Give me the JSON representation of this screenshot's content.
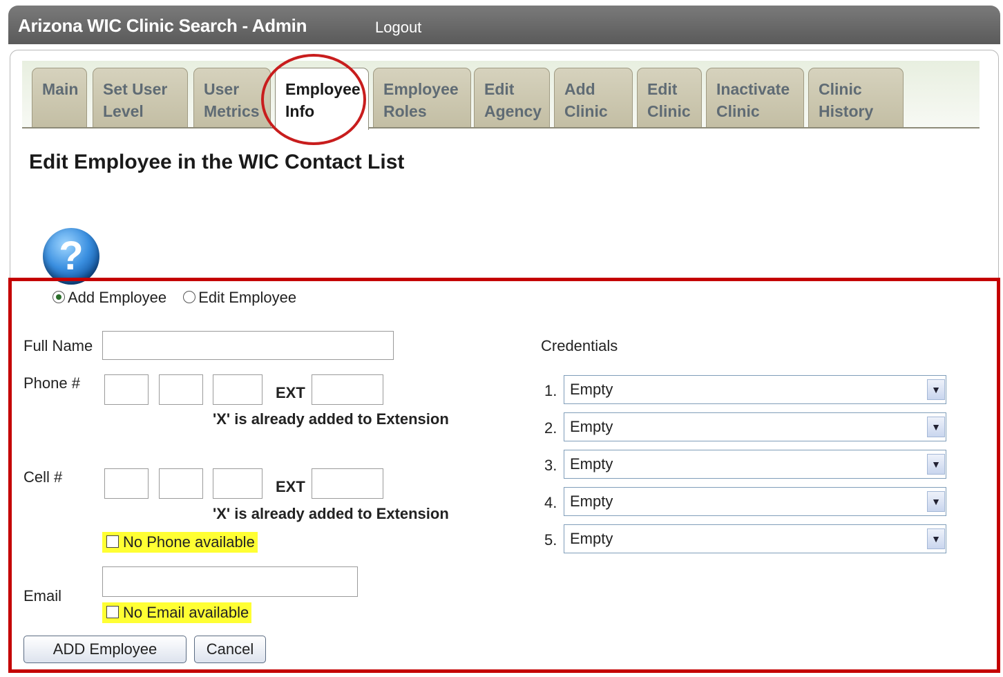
{
  "header": {
    "title": "Arizona WIC Clinic Search - Admin",
    "logout_label": "Logout"
  },
  "tabs": [
    {
      "line1": "Main",
      "line2": ""
    },
    {
      "line1": "Set User",
      "line2": "Level"
    },
    {
      "line1": "User",
      "line2": "Metrics"
    },
    {
      "line1": "Employee",
      "line2": "Info",
      "active": true
    },
    {
      "line1": "Employee",
      "line2": "Roles"
    },
    {
      "line1": "Edit",
      "line2": "Agency"
    },
    {
      "line1": "Add",
      "line2": "Clinic"
    },
    {
      "line1": "Edit",
      "line2": "Clinic"
    },
    {
      "line1": "Inactivate",
      "line2": "Clinic"
    },
    {
      "line1": "Clinic",
      "line2": "History"
    }
  ],
  "page": {
    "title": "Edit Employee in the WIC Contact List",
    "help_icon": "help-question-icon"
  },
  "form": {
    "mode_options": [
      "Add Employee",
      "Edit Employee"
    ],
    "mode_selected": "Add Employee",
    "full_name_label": "Full Name",
    "full_name_value": "",
    "phone_label": "Phone #",
    "cell_label": "Cell #",
    "ext_label": "EXT",
    "ext_note": "'X' is already added to Extension",
    "no_phone_label": "No Phone available",
    "email_label": "Email",
    "email_value": "",
    "no_email_label": "No Email available",
    "add_button": "ADD Employee",
    "cancel_button": "Cancel"
  },
  "credentials": {
    "label": "Credentials",
    "items": [
      {
        "num": "1.",
        "value": "Empty"
      },
      {
        "num": "2.",
        "value": "Empty"
      },
      {
        "num": "3.",
        "value": "Empty"
      },
      {
        "num": "4.",
        "value": "Empty"
      },
      {
        "num": "5.",
        "value": "Empty"
      }
    ]
  },
  "colors": {
    "highlight": "#c40000",
    "tab_bg": "#c9c4aa",
    "note_bg": "#ffff33"
  }
}
